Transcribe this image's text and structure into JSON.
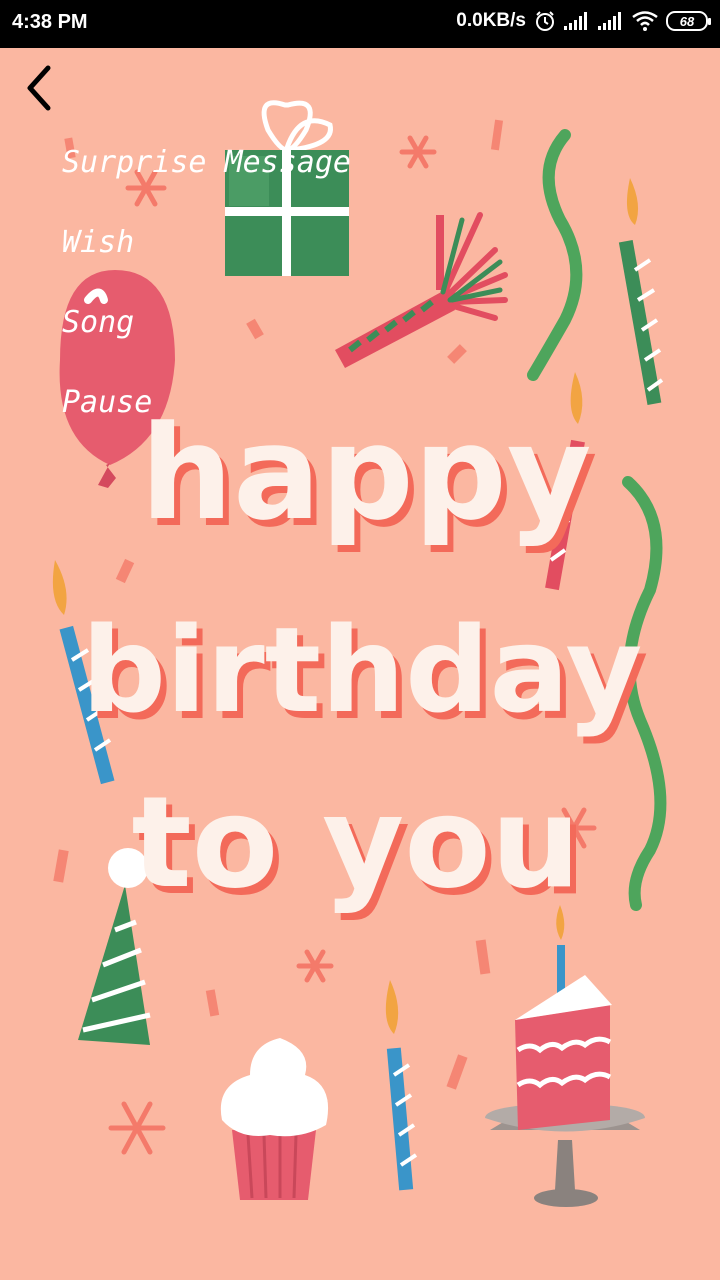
{
  "status_bar": {
    "time": "4:38 PM",
    "network_speed": "0.0KB/s",
    "battery_level": "68",
    "icons": [
      "alarm-icon",
      "signal-icon",
      "signal-icon",
      "wifi-icon",
      "battery-icon"
    ]
  },
  "header": {
    "back_icon": "back-arrow-icon"
  },
  "menu": {
    "items": [
      {
        "label": "Surprise Message"
      },
      {
        "label": "Wish"
      },
      {
        "label": "Song"
      },
      {
        "label": "Pause"
      }
    ]
  },
  "card": {
    "background_color": "#fbb7a1",
    "line1": "happy",
    "line2": "birthday",
    "line3": "to you"
  }
}
